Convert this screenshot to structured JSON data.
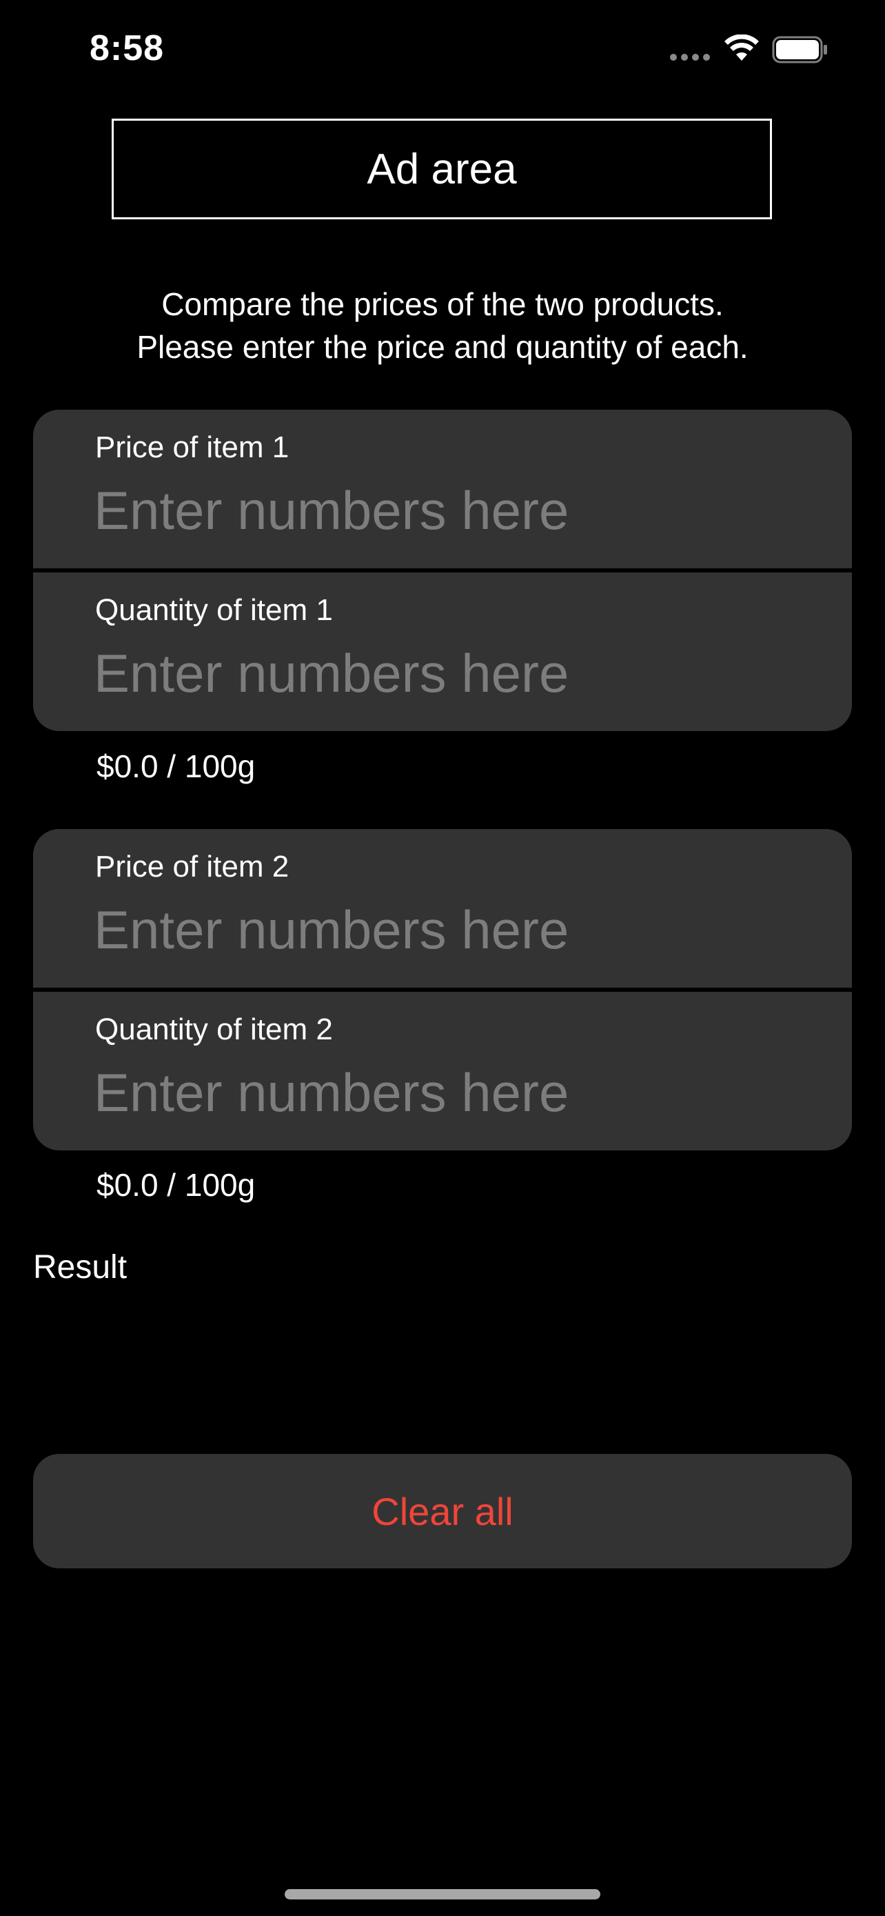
{
  "status_bar": {
    "time": "8:58",
    "icons": [
      "cellular-signal-icon",
      "wifi-icon",
      "battery-icon"
    ]
  },
  "ad": {
    "label": "Ad area"
  },
  "instructions": {
    "line1": "Compare the prices of the two products.",
    "line2": "Please enter the price and quantity of each."
  },
  "items": [
    {
      "price_label": "Price of item 1",
      "price_value": "",
      "price_placeholder": "Enter numbers here",
      "quantity_label": "Quantity of item 1",
      "quantity_value": "",
      "quantity_placeholder": "Enter numbers here",
      "unit_price": "$0.0 / 100g"
    },
    {
      "price_label": "Price of item 2",
      "price_value": "",
      "price_placeholder": "Enter numbers here",
      "quantity_label": "Quantity of item 2",
      "quantity_value": "",
      "quantity_placeholder": "Enter numbers here",
      "unit_price": "$0.0 / 100g"
    }
  ],
  "result": {
    "label": "Result"
  },
  "actions": {
    "clear_label": "Clear all"
  },
  "colors": {
    "background": "#000000",
    "card": "#333333",
    "placeholder": "#7d7d7d",
    "destructive": "#f0453a",
    "text": "#ffffff"
  }
}
